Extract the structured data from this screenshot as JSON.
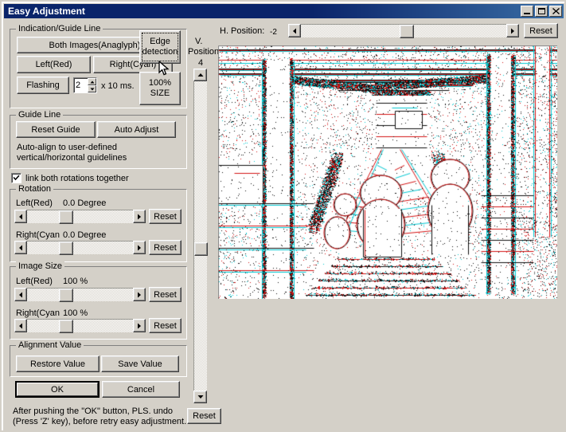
{
  "window": {
    "title": "Easy Adjustment",
    "buttons": {
      "minimize": "minimize-button",
      "maximize": "maximize-button",
      "close": "close-button"
    }
  },
  "indication_group": {
    "legend": "Indication/Guide Line",
    "both_images": "Both Images(Anaglyph)",
    "left_red": "Left(Red)",
    "right_cyan": "Right(Cyan)",
    "flashing": "Flashing",
    "interval_value": "2",
    "interval_unit": "x 10 ms."
  },
  "mode_buttons": {
    "edge_detection": "Edge\ndetection",
    "edge_detection_line1": "Edge",
    "edge_detection_line2": "detection",
    "size_100_line1": "100%",
    "size_100_line2": "SIZE"
  },
  "guide_group": {
    "legend": "Guide Line",
    "reset_guide": "Reset Guide",
    "auto_adjust": "Auto Adjust",
    "hint_line1": "Auto-align to user-defined",
    "hint_line2": "vertical/horizontal guidelines"
  },
  "link_checkbox": {
    "label": "link both rotations together",
    "checked": true
  },
  "rotation_group": {
    "legend": "Rotation",
    "left_label": "Left(Red)",
    "left_value": "0.0 Degree",
    "left_reset": "Reset",
    "left_thumb_pct": 30,
    "right_label": "Right(Cyan",
    "right_value": "0.0 Degree",
    "right_reset": "Reset",
    "right_thumb_pct": 30
  },
  "image_size_group": {
    "legend": "Image Size",
    "left_label": "Left(Red)",
    "left_value": "100 %",
    "left_reset": "Reset",
    "left_thumb_pct": 30,
    "right_label": "Right(Cyan",
    "right_value": "100 %",
    "right_reset": "Reset",
    "right_thumb_pct": 30
  },
  "alignment_group": {
    "legend": "Alignment Value",
    "restore_value": "Restore Value",
    "save_value": "Save Value"
  },
  "dialog_buttons": {
    "ok": "OK",
    "cancel": "Cancel"
  },
  "footer_hint": {
    "line1": "After pushing the \"OK\" button, PLS. undo",
    "line2": "(Press 'Z' key), before retry easy adjustment."
  },
  "h_position": {
    "label": "H. Position:",
    "value": "-2",
    "reset": "Reset",
    "thumb_pct": 48
  },
  "v_position": {
    "label_line1": "V.",
    "label_line2": "Position",
    "value": "4",
    "reset": "Reset",
    "thumb_pct": 52
  },
  "preview": {
    "description": "anaglyph edge-detection preview of a shrine torii gate corridor",
    "background": "#ffffff",
    "red": "#d41414",
    "cyan": "#00c8d2",
    "black": "#101010"
  }
}
